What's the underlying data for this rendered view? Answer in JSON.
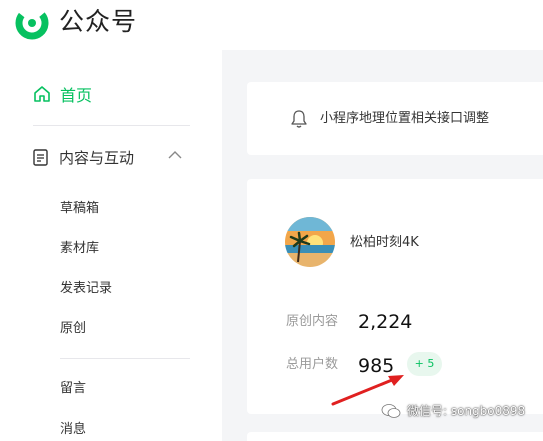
{
  "brand": {
    "name": "公众号",
    "accent": "#07c160"
  },
  "sidebar": {
    "home_label": "首页",
    "group_label": "内容与互动",
    "items": [
      "草稿箱",
      "素材库",
      "发表记录",
      "原创",
      "留言",
      "消息"
    ]
  },
  "notice": {
    "text": "小程序地理位置相关接口调整",
    "icon": "bell-icon"
  },
  "account": {
    "name": "松柏时刻4K",
    "stats": [
      {
        "label": "原创内容",
        "value": "2,224"
      },
      {
        "label": "总用户数",
        "value": "985",
        "delta": "+ 5"
      }
    ]
  },
  "watermark": {
    "text": "微信号: songbo0898"
  }
}
